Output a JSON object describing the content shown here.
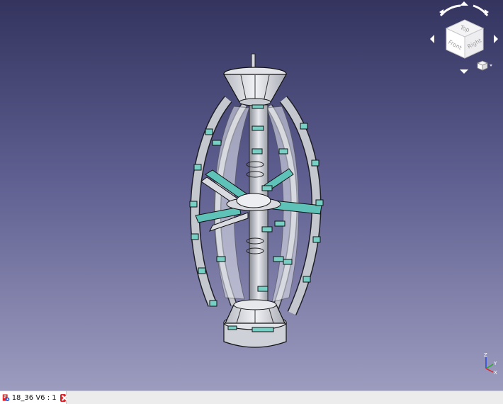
{
  "viewport": {
    "background_top": "#34345f",
    "background_bottom": "#9c9cbf",
    "model_colors": {
      "frame": "#c9cbd2",
      "glass": "#dfe3ea",
      "blade": "#5fc2b8",
      "edge": "#1a1a1a"
    }
  },
  "navcube": {
    "faces": {
      "top": "Top",
      "front": "Front",
      "right": "Right"
    }
  },
  "axis": {
    "x": "X",
    "y": "Y",
    "z": "Z",
    "x_color": "#e0201e",
    "y_color": "#20b020",
    "z_color": "#2040e0"
  },
  "tabs": [
    {
      "label": "18_36 V6 : 1",
      "icon": "freecad-document-icon",
      "close_icon": "close-tab-icon"
    }
  ]
}
